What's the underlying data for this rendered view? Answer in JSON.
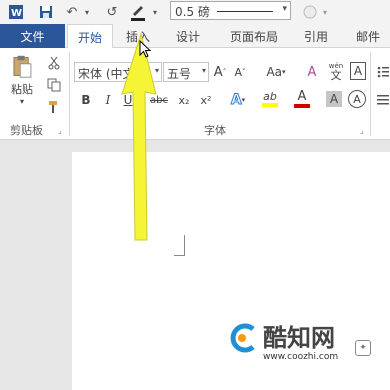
{
  "quick_access": {
    "border_weight_value": "0.5 磅"
  },
  "tabs": {
    "file": "文件",
    "home": "开始",
    "insert": "插入",
    "design": "设计",
    "layout": "页面布局",
    "references": "引用",
    "mailings": "邮件"
  },
  "ribbon": {
    "clipboard": {
      "paste_label": "粘贴",
      "group_label": "剪贴板"
    },
    "font": {
      "font_name": "宋体 (中文正",
      "font_size": "五号",
      "group_label": "字体",
      "grow_label": "A",
      "shrink_label": "A",
      "case_label": "Aa",
      "clear_label": "A",
      "phonetic_label": "wén",
      "phonetic_sub": "文",
      "border_char_label": "A",
      "bold_label": "B",
      "italic_label": "I",
      "underline_label": "U",
      "strike_label": "abc",
      "sub_label": "x₂",
      "sup_label": "x²",
      "effects_label": "A",
      "highlight_label": "ab",
      "color_label": "A",
      "shade_label": "A",
      "circled_label": "A"
    }
  },
  "watermark": {
    "brand": "酷知网",
    "url": "www.coozhi.com"
  },
  "colors": {
    "file_tab": "#2b579a",
    "arrow": "#f5f535",
    "highlight_bar": "#ffff00",
    "font_color_bar": "#d00000",
    "watermark_blue": "#1f8fd6",
    "watermark_orange": "#f39c12"
  }
}
